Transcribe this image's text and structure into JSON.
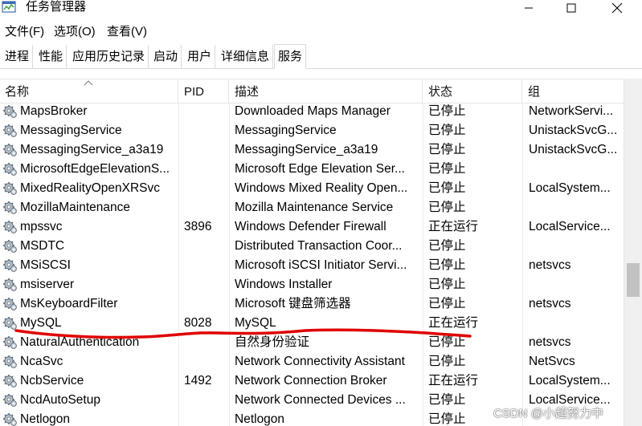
{
  "window": {
    "title": "任务管理器"
  },
  "menu": {
    "file": "文件(F)",
    "options": "选项(O)",
    "view": "查看(V)"
  },
  "tabs": [
    {
      "label": "进程"
    },
    {
      "label": "性能"
    },
    {
      "label": "应用历史记录"
    },
    {
      "label": "启动"
    },
    {
      "label": "用户"
    },
    {
      "label": "详细信息"
    },
    {
      "label": "服务",
      "active": true
    }
  ],
  "columns": {
    "name": "名称",
    "pid": "PID",
    "desc": "描述",
    "status": "状态",
    "group": "组"
  },
  "rows": [
    {
      "name": "MapsBroker",
      "pid": "",
      "desc": "Downloaded Maps Manager",
      "status": "已停止",
      "group": "NetworkServi..."
    },
    {
      "name": "MessagingService",
      "pid": "",
      "desc": "MessagingService",
      "status": "已停止",
      "group": "UnistackSvcG..."
    },
    {
      "name": "MessagingService_a3a19",
      "pid": "",
      "desc": "MessagingService_a3a19",
      "status": "已停止",
      "group": "UnistackSvcG..."
    },
    {
      "name": "MicrosoftEdgeElevationS...",
      "pid": "",
      "desc": "Microsoft Edge Elevation Ser...",
      "status": "已停止",
      "group": ""
    },
    {
      "name": "MixedRealityOpenXRSvc",
      "pid": "",
      "desc": "Windows Mixed Reality Open...",
      "status": "已停止",
      "group": "LocalSystem..."
    },
    {
      "name": "MozillaMaintenance",
      "pid": "",
      "desc": "Mozilla Maintenance Service",
      "status": "已停止",
      "group": ""
    },
    {
      "name": "mpssvc",
      "pid": "3896",
      "desc": "Windows Defender Firewall",
      "status": "正在运行",
      "group": "LocalService..."
    },
    {
      "name": "MSDTC",
      "pid": "",
      "desc": "Distributed Transaction Coor...",
      "status": "已停止",
      "group": ""
    },
    {
      "name": "MSiSCSI",
      "pid": "",
      "desc": "Microsoft iSCSI Initiator Servi...",
      "status": "已停止",
      "group": "netsvcs"
    },
    {
      "name": "msiserver",
      "pid": "",
      "desc": "Windows Installer",
      "status": "已停止",
      "group": ""
    },
    {
      "name": "MsKeyboardFilter",
      "pid": "",
      "desc": "Microsoft 键盘筛选器",
      "status": "已停止",
      "group": "netsvcs"
    },
    {
      "name": "MySQL",
      "pid": "8028",
      "desc": "MySQL",
      "status": "正在运行",
      "group": ""
    },
    {
      "name": "NaturalAuthentication",
      "pid": "",
      "desc": "自然身份验证",
      "status": "已停止",
      "group": "netsvcs"
    },
    {
      "name": "NcaSvc",
      "pid": "",
      "desc": "Network Connectivity Assistant",
      "status": "已停止",
      "group": "NetSvcs"
    },
    {
      "name": "NcbService",
      "pid": "1492",
      "desc": "Network Connection Broker",
      "status": "正在运行",
      "group": "LocalSystem..."
    },
    {
      "name": "NcdAutoSetup",
      "pid": "",
      "desc": "Network Connected Devices ...",
      "status": "已停止",
      "group": "LocalService..."
    },
    {
      "name": "Netlogon",
      "pid": "",
      "desc": "Netlogon",
      "status": "已停止",
      "group": ""
    }
  ],
  "watermark": "CSDN @小超努力中",
  "colors": {
    "annotation": "#e00000"
  }
}
